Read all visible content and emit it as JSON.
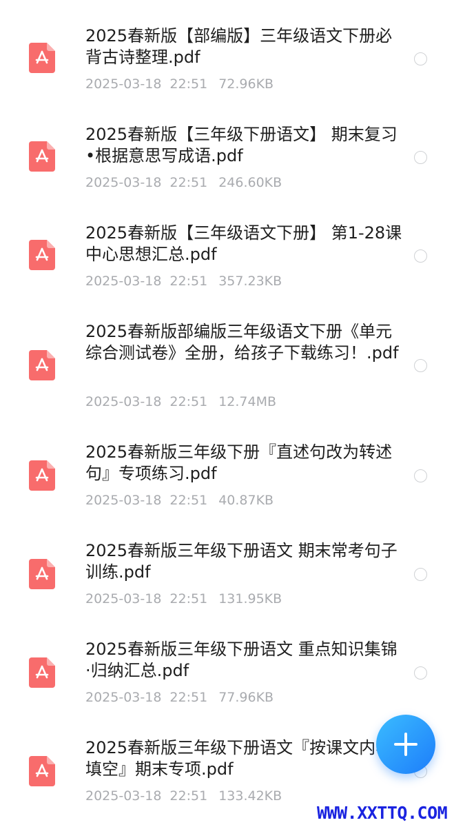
{
  "files": [
    {
      "name": "2025春新版【部编版】三年级语文下册必背古诗整理.pdf",
      "date": "2025-03-18",
      "time": "22:51",
      "size": "72.96KB"
    },
    {
      "name": "2025春新版【三年级下册语文】 期末复习•根据意思写成语.pdf",
      "date": "2025-03-18",
      "time": "22:51",
      "size": "246.60KB"
    },
    {
      "name": "2025春新版【三年级语文下册】 第1-28课中心思想汇总.pdf",
      "date": "2025-03-18",
      "time": "22:51",
      "size": "357.23KB"
    },
    {
      "name": "2025春新版部编版三年级语文下册《单元综合测试卷》全册，给孩子下载练习！.pdf",
      "date": "2025-03-18",
      "time": "22:51",
      "size": "12.74MB"
    },
    {
      "name": "2025春新版三年级下册『直述句改为转述句』专项练习.pdf",
      "date": "2025-03-18",
      "time": "22:51",
      "size": "40.87KB"
    },
    {
      "name": "2025春新版三年级下册语文 期末常考句子训练.pdf",
      "date": "2025-03-18",
      "time": "22:51",
      "size": "131.95KB"
    },
    {
      "name": "2025春新版三年级下册语文 重点知识集锦·归纳汇总.pdf",
      "date": "2025-03-18",
      "time": "22:51",
      "size": "77.96KB"
    },
    {
      "name": "2025春新版三年级下册语文『按课文内容填空』期末专项.pdf",
      "date": "2025-03-18",
      "time": "22:51",
      "size": "133.42KB"
    }
  ],
  "icons": {
    "file": "pdf-file-icon",
    "fab": "plus-icon",
    "select": "radio-icon"
  },
  "colors": {
    "pdf_icon": "#f86c6c",
    "fab": "#1d7dfa",
    "watermark": "#1a23e0"
  },
  "watermark": "WWW.XXTTQ.COM"
}
